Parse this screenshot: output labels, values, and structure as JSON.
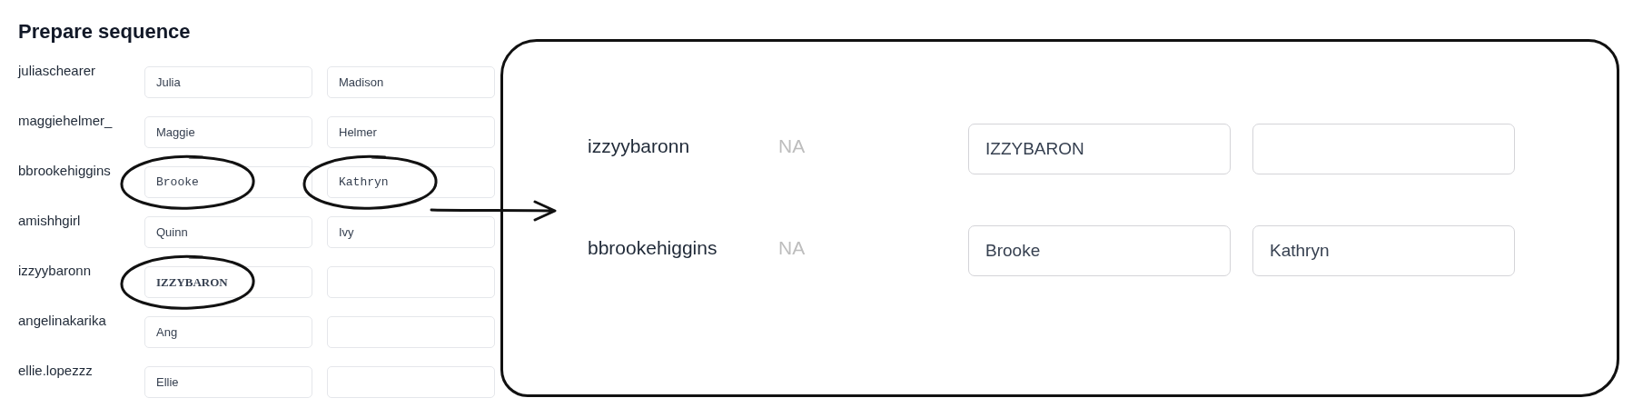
{
  "title": "Prepare sequence",
  "rows": [
    {
      "username": "juliaschearer",
      "first_name": {
        "value": "Julia",
        "kind": "plain",
        "circled": false
      },
      "last_name": {
        "value": "Madison",
        "kind": "plain",
        "circled": false
      }
    },
    {
      "username": "maggiehelmer_",
      "first_name": {
        "value": "Maggie",
        "kind": "plain",
        "circled": false
      },
      "last_name": {
        "value": "Helmer",
        "kind": "plain",
        "circled": false
      }
    },
    {
      "username": "bbrookehiggins",
      "first_name": {
        "value": "Brooke",
        "kind": "typewriter",
        "circled": true
      },
      "last_name": {
        "value": "Kathryn",
        "kind": "typewriter",
        "circled": true
      }
    },
    {
      "username": "amishhgirl",
      "first_name": {
        "value": "Quinn",
        "kind": "plain",
        "circled": false
      },
      "last_name": {
        "value": "Ivy",
        "kind": "plain",
        "circled": false
      }
    },
    {
      "username": "izzyybaronn",
      "first_name": {
        "value": "IZZYBARON",
        "kind": "bold-serif",
        "circled": true
      },
      "last_name": {
        "kind": "plain",
        "circled": false
      }
    },
    {
      "username": "angelinakarika",
      "first_name": {
        "value": "Ang",
        "kind": "plain",
        "circled": false
      },
      "last_name": {
        "kind": "plain",
        "circled": false
      }
    },
    {
      "username": "ellie.lopezzz",
      "first_name": {
        "value": "Ellie",
        "kind": "plain",
        "circled": false
      },
      "last_name": {
        "kind": "plain",
        "circled": false
      }
    }
  ],
  "detail": {
    "rows": [
      {
        "username": "izzyybaronn",
        "status": "NA",
        "first_name": "IZZYBARON"
      },
      {
        "username": "bbrookehiggins",
        "status": "NA",
        "first_name": "Brooke",
        "last_name": "Kathryn"
      }
    ]
  }
}
